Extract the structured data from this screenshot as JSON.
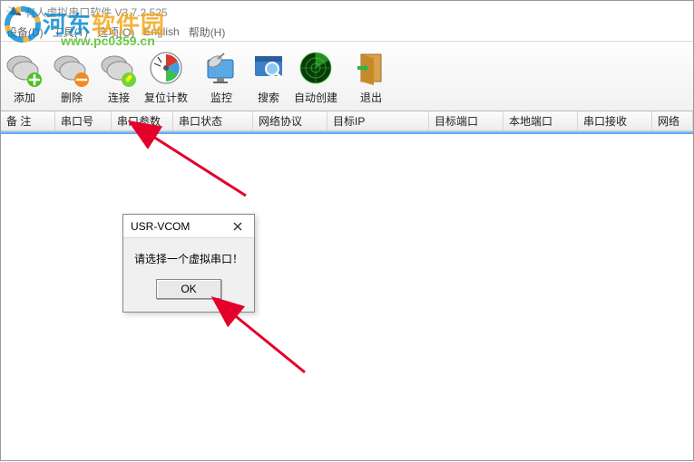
{
  "title_bar": {
    "title": "有人虚拟串口软件 V3.7.2.525"
  },
  "menu_bar": {
    "items": [
      "设备(D)",
      "工具(T)",
      "选项(O)",
      "English",
      "帮助(H)"
    ]
  },
  "watermark": {
    "brand_left": "河东",
    "brand_right": "软件园",
    "url": "www.pc0359.cn"
  },
  "toolbar": {
    "add": "添加",
    "delete": "删除",
    "connect": "连接",
    "reset_count": "复位计数",
    "monitor": "监控",
    "search": "搜索",
    "auto_create": "自动创建",
    "exit": "退出"
  },
  "columns": {
    "c0": "备 注",
    "c1": "串口号",
    "c2": "串口参数",
    "c3": "串口状态",
    "c4": "网络协议",
    "c5": "目标IP",
    "c6": "目标端口",
    "c7": "本地端口",
    "c8": "串口接收",
    "c9": "网络"
  },
  "dialog": {
    "title": "USR-VCOM",
    "message": "请选择一个虚拟串口！",
    "ok": "OK"
  }
}
